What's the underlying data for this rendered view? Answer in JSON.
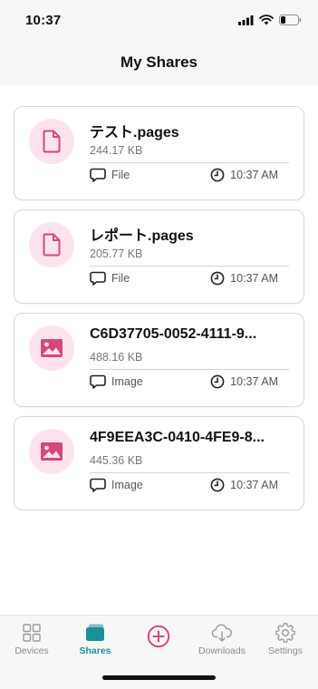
{
  "status_bar": {
    "time": "10:37"
  },
  "header": {
    "title": "My Shares"
  },
  "colors": {
    "accent": "#d6477f",
    "active_tab": "#1b8f9a",
    "icon_bg": "#fde3ee"
  },
  "shares": [
    {
      "name": "テスト.pages",
      "size": "244.17 KB",
      "type": "File",
      "time": "10:37 AM",
      "icon": "document-icon"
    },
    {
      "name": "レポート.pages",
      "size": "205.77 KB",
      "type": "File",
      "time": "10:37 AM",
      "icon": "document-icon"
    },
    {
      "name": "C6D37705-0052-4111-9...",
      "size": "488.16 KB",
      "type": "Image",
      "time": "10:37 AM",
      "icon": "image-icon"
    },
    {
      "name": "4F9EEA3C-0410-4FE9-8...",
      "size": "445.36 KB",
      "type": "Image",
      "time": "10:37 AM",
      "icon": "image-icon"
    }
  ],
  "tabs": [
    {
      "label": "Devices",
      "icon": "devices-icon",
      "active": false
    },
    {
      "label": "Shares",
      "icon": "shares-icon",
      "active": true
    },
    {
      "label": "",
      "icon": "add-circle-icon",
      "active": false
    },
    {
      "label": "Downloads",
      "icon": "cloud-download-icon",
      "active": false
    },
    {
      "label": "Settings",
      "icon": "gear-icon",
      "active": false
    }
  ]
}
